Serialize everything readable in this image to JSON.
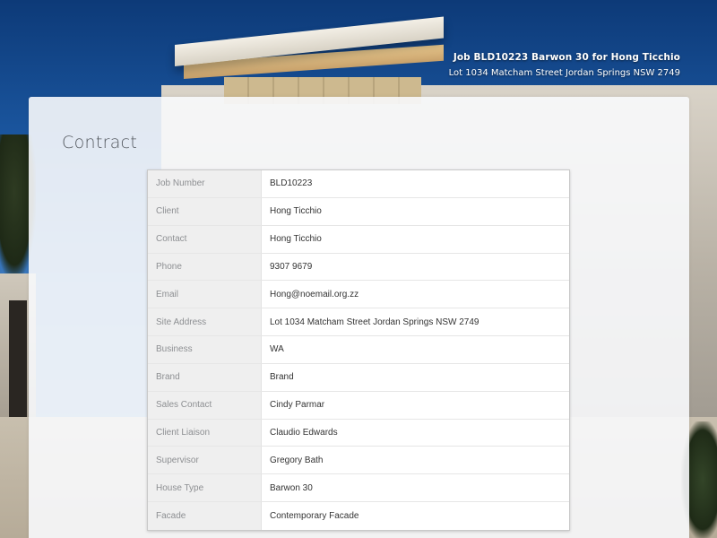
{
  "header": {
    "job_title": "Job BLD10223 Barwon 30 for Hong Ticchio",
    "job_address": "Lot 1034 Matcham Street Jordan Springs NSW 2749"
  },
  "contract": {
    "title": "Contract",
    "rows": [
      {
        "label": "Job Number",
        "value": "BLD10223"
      },
      {
        "label": "Client",
        "value": "Hong Ticchio"
      },
      {
        "label": "Contact",
        "value": "Hong Ticchio"
      },
      {
        "label": "Phone",
        "value": "9307 9679"
      },
      {
        "label": "Email",
        "value": "Hong@noemail.org.zz"
      },
      {
        "label": "Site Address",
        "value": "Lot 1034 Matcham Street Jordan Springs NSW 2749"
      },
      {
        "label": "Business",
        "value": "WA"
      },
      {
        "label": "Brand",
        "value": "Brand"
      },
      {
        "label": "Sales Contact",
        "value": "Cindy Parmar"
      },
      {
        "label": "Client Liaison",
        "value": "Claudio Edwards"
      },
      {
        "label": "Supervisor",
        "value": "Gregory Bath"
      },
      {
        "label": "House Type",
        "value": "Barwon 30"
      },
      {
        "label": "Facade",
        "value": "Contemporary Facade"
      }
    ]
  },
  "colors": {
    "sky": "#1d5ba6",
    "label_bg": "#efefef",
    "label_text": "#8d8f92",
    "value_text": "#333333",
    "title_text": "#555a60"
  }
}
